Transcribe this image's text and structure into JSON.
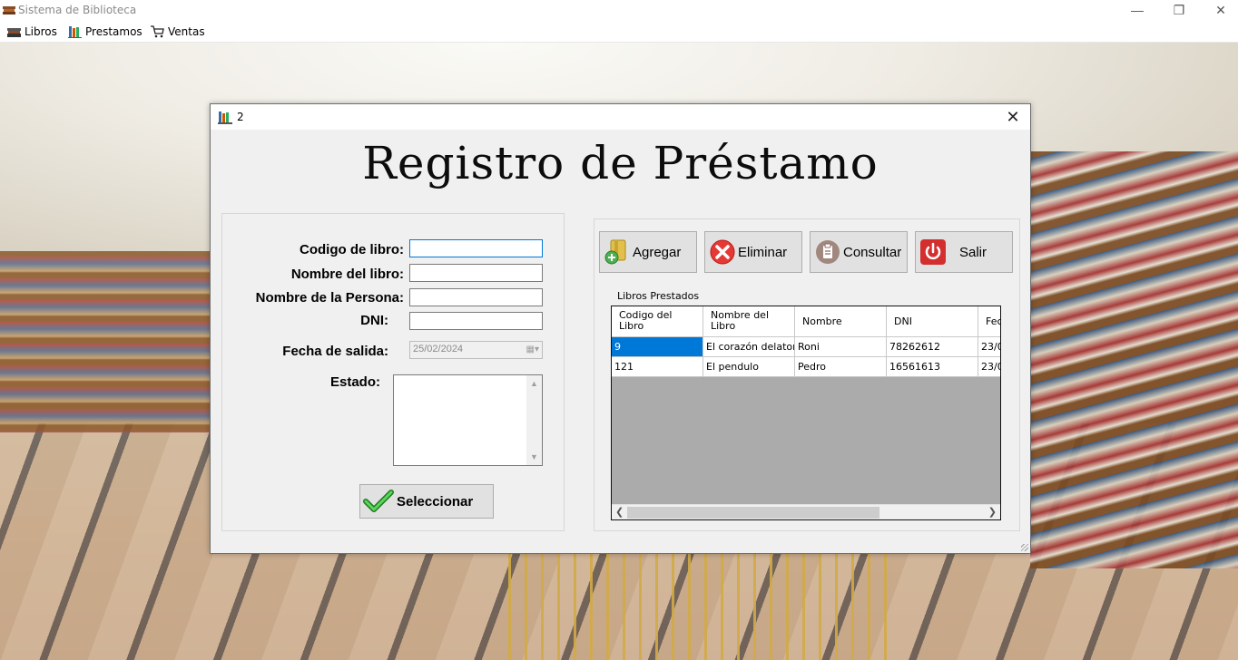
{
  "app": {
    "title": "Sistema de Biblioteca"
  },
  "window_controls": {
    "minimize": "—",
    "maximize": "❐",
    "close": "✕"
  },
  "menu": [
    {
      "label": "Libros",
      "icon": "books-icon"
    },
    {
      "label": "Prestamos",
      "icon": "library-icon"
    },
    {
      "label": "Ventas",
      "icon": "cart-icon"
    }
  ],
  "dialog": {
    "title": "2",
    "close": "✕",
    "heading": "Registro de Préstamo",
    "form": {
      "codigo_label": "Codigo de libro:",
      "codigo_value": "",
      "nombre_libro_label": "Nombre del libro:",
      "nombre_libro_value": "",
      "nombre_persona_label": "Nombre de la Persona:",
      "nombre_persona_value": "",
      "dni_label": "DNI:",
      "dni_value": "",
      "fecha_label": "Fecha de salida:",
      "fecha_value": "25/02/2024",
      "estado_label": "Estado:",
      "estado_value": "",
      "select_button": "Seleccionar"
    },
    "actions": [
      {
        "label": "Agregar",
        "icon": "add-folder-icon"
      },
      {
        "label": "Eliminar",
        "icon": "delete-x-icon"
      },
      {
        "label": "Consultar",
        "icon": "clipboard-icon"
      },
      {
        "label": "Salir",
        "icon": "power-icon"
      }
    ],
    "grid": {
      "caption": "Libros Prestados",
      "columns": [
        "Codigo del Libro",
        "Nombre del Libro",
        "Nombre",
        "DNI",
        "Fec"
      ],
      "column_lines": [
        [
          "Codigo del",
          "Libro"
        ],
        [
          "Nombre del",
          "Libro"
        ],
        [
          "Nombre"
        ],
        [
          "DNI"
        ],
        [
          "Fec"
        ]
      ],
      "rows": [
        [
          "9",
          "El corazón delator",
          "Roni",
          "78262612",
          "23/0"
        ],
        [
          "121",
          "El pendulo",
          "Pedro",
          "16561613",
          "23/0"
        ]
      ]
    }
  },
  "colors": {
    "selection": "#0078d7",
    "focus_border": "#0078d7"
  }
}
